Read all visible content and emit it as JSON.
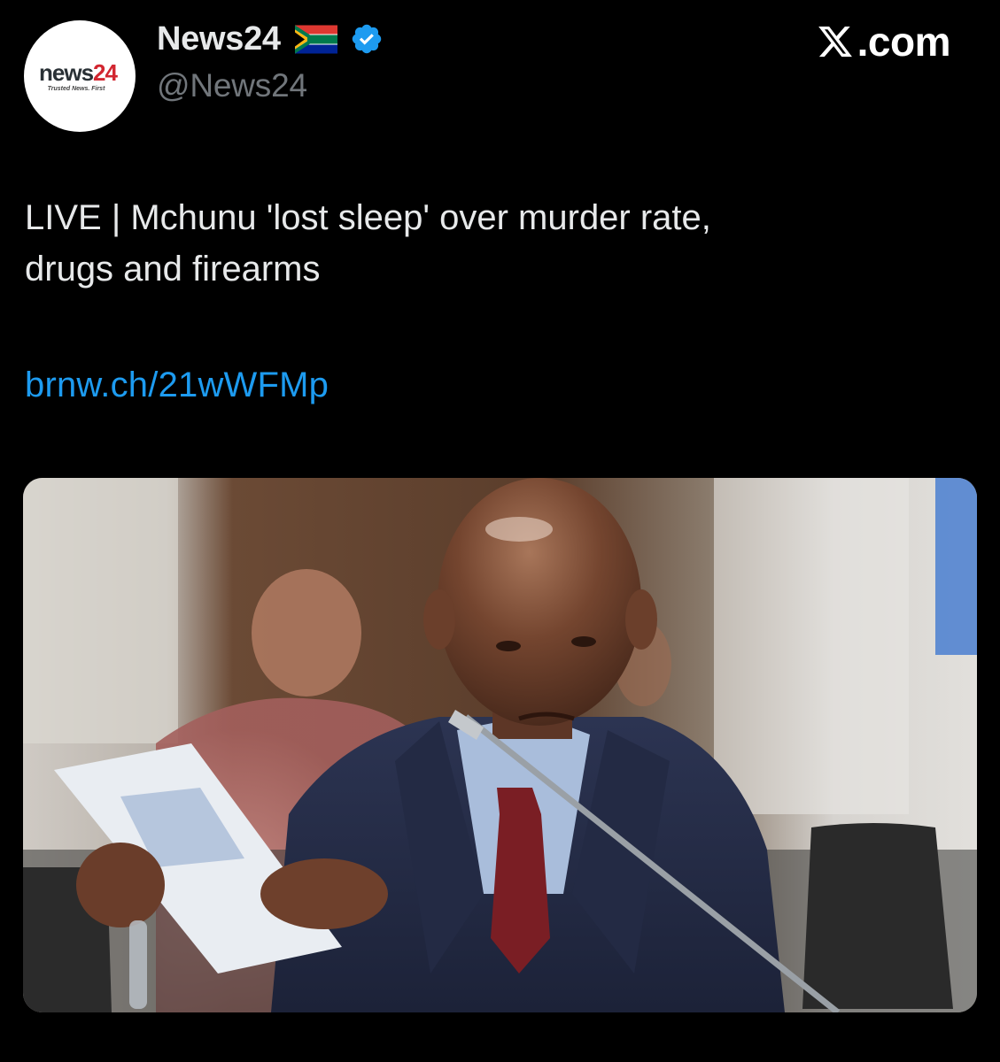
{
  "account": {
    "avatar_word_news": "news",
    "avatar_word_num": "24",
    "avatar_tagline": "Trusted News. First",
    "display_name": "News24",
    "handle": "@News24",
    "verified": true,
    "flag": "south-africa-flag-icon"
  },
  "watermark": {
    "brand_text": ".com",
    "brand_logo": "x-logo-icon"
  },
  "tweet": {
    "text_line_1": "LIVE | Mchunu 'lost sleep' over murder rate,",
    "text_line_2": "drugs and firearms",
    "link": "brnw.ch/21wWFMp"
  },
  "media": {
    "type": "photo"
  },
  "colors": {
    "background": "#000000",
    "text": "#e7e9ea",
    "secondary_text": "#71767b",
    "link": "#1d9bf0",
    "verified": "#1d9bf0"
  }
}
